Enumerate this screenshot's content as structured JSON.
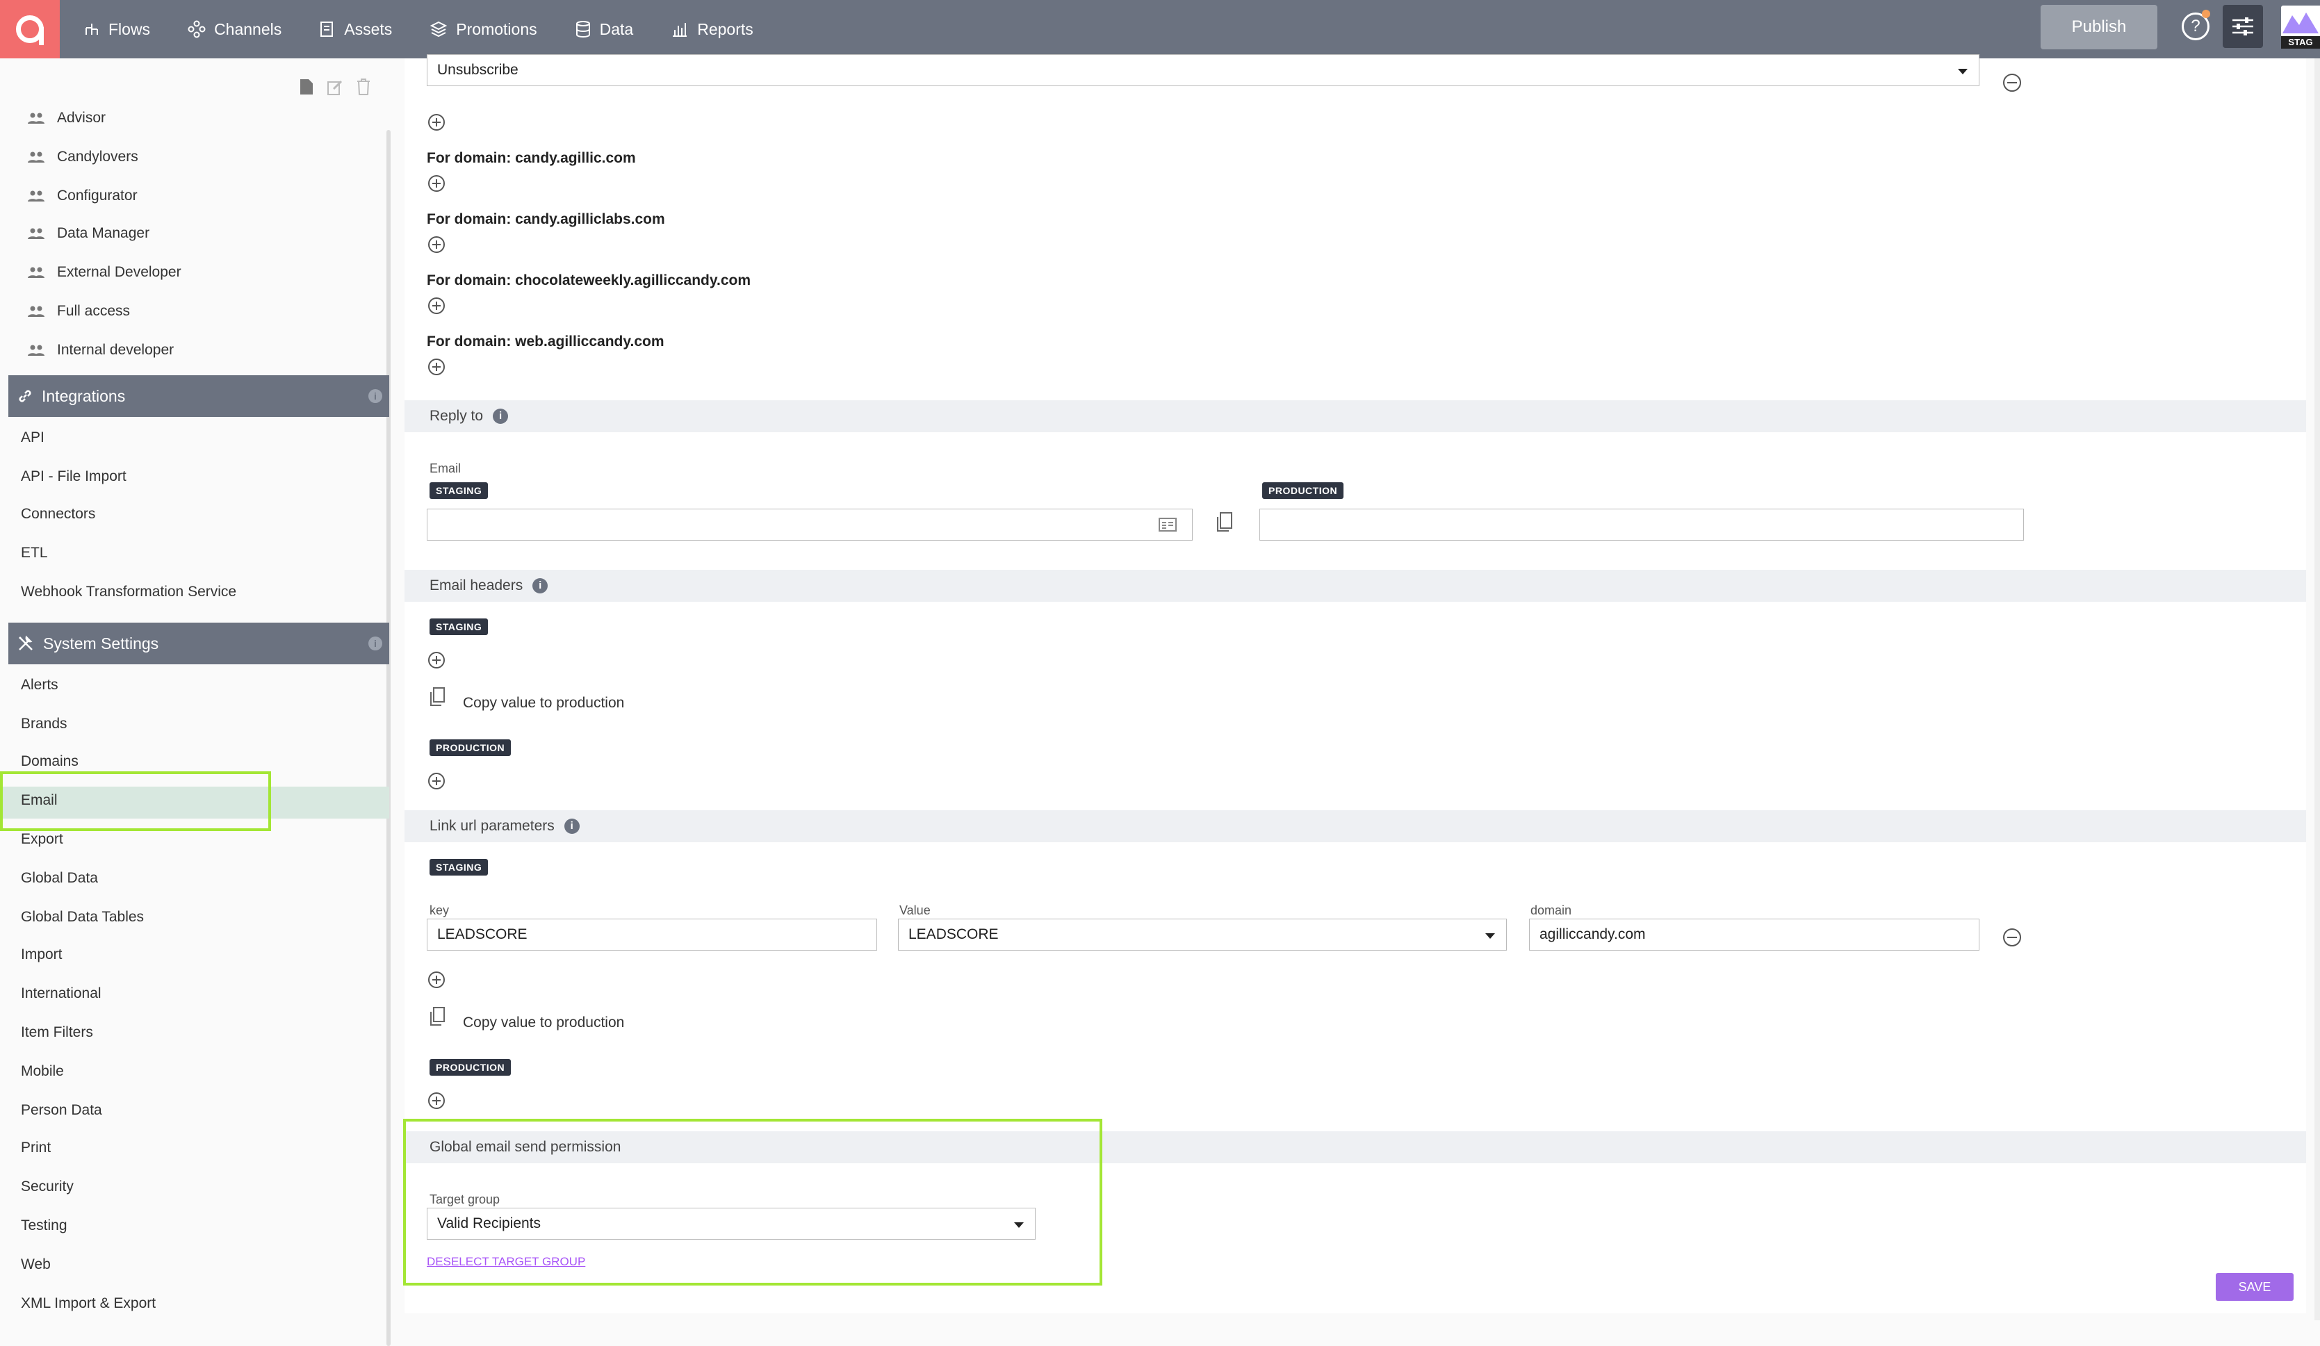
{
  "topbar": {
    "nav": [
      {
        "label": "Flows",
        "icon": "flows-icon"
      },
      {
        "label": "Channels",
        "icon": "channels-icon"
      },
      {
        "label": "Assets",
        "icon": "assets-icon"
      },
      {
        "label": "Promotions",
        "icon": "promotions-icon"
      },
      {
        "label": "Data",
        "icon": "database-icon"
      },
      {
        "label": "Reports",
        "icon": "reports-icon"
      }
    ],
    "publish_label": "Publish",
    "help_label": "?",
    "env_label": "STAG"
  },
  "sidebar": {
    "roles": [
      "Advisor",
      "Candylovers",
      "Configurator",
      "Data Manager",
      "External Developer",
      "Full access",
      "Internal developer"
    ],
    "integrations": {
      "title": "Integrations",
      "items": [
        "API",
        "API - File Import",
        "Connectors",
        "ETL",
        "Webhook Transformation Service"
      ]
    },
    "system_settings": {
      "title": "System Settings",
      "items": [
        "Alerts",
        "Brands",
        "Domains",
        "Email",
        "Export",
        "Global Data",
        "Global Data Tables",
        "Import",
        "International",
        "Item Filters",
        "Mobile",
        "Person Data",
        "Print",
        "Security",
        "Testing",
        "Web",
        "XML Import & Export"
      ],
      "active": "Email"
    },
    "info_label": "i"
  },
  "main": {
    "unsubscribe_value": "Unsubscribe",
    "domains": [
      "For domain: candy.agillic.com",
      "For domain: candy.agilliclabs.com",
      "For domain: chocolateweekly.agilliccandy.com",
      "For domain: web.agilliccandy.com"
    ],
    "reply_to": {
      "title": "Reply to",
      "email_label": "Email",
      "staging_badge": "STAGING",
      "production_badge": "PRODUCTION",
      "staging_value": "",
      "production_value": ""
    },
    "email_headers": {
      "title": "Email headers",
      "staging_badge": "STAGING",
      "production_badge": "PRODUCTION",
      "copy_label": "Copy value to production"
    },
    "link_params": {
      "title": "Link url parameters",
      "staging_badge": "STAGING",
      "production_badge": "PRODUCTION",
      "key_label": "key",
      "value_label": "Value",
      "domain_label": "domain",
      "key_value": "LEADSCORE",
      "value_value": "LEADSCORE",
      "domain_value": "agilliccandy.com",
      "copy_label": "Copy value to production"
    },
    "global_permission": {
      "title": "Global email send permission",
      "target_label": "Target group",
      "target_value": "Valid Recipients",
      "deselect_label": "DESELECT TARGET GROUP"
    },
    "save_label": "SAVE",
    "info_label": "i"
  },
  "colors": {
    "topbar": "#6b7280",
    "logo": "#f26d6d",
    "highlight": "#a3e635",
    "accent": "#a16ae8"
  }
}
